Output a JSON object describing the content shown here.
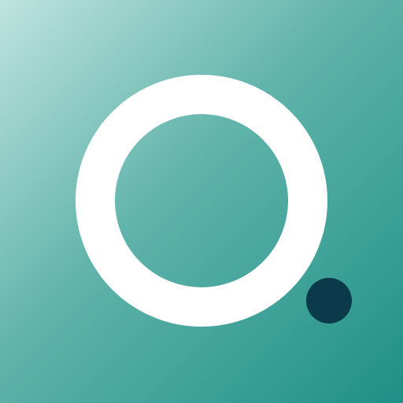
{
  "icon": {
    "semantic_name": "app-logo-icon",
    "shapes": [
      "ring",
      "dot"
    ],
    "colors": {
      "gradient_start": "#bfe3df",
      "gradient_mid": "#5fb3aa",
      "gradient_end": "#1f9087",
      "ring": "#ffffff",
      "dot": "#0b3a4a"
    }
  }
}
